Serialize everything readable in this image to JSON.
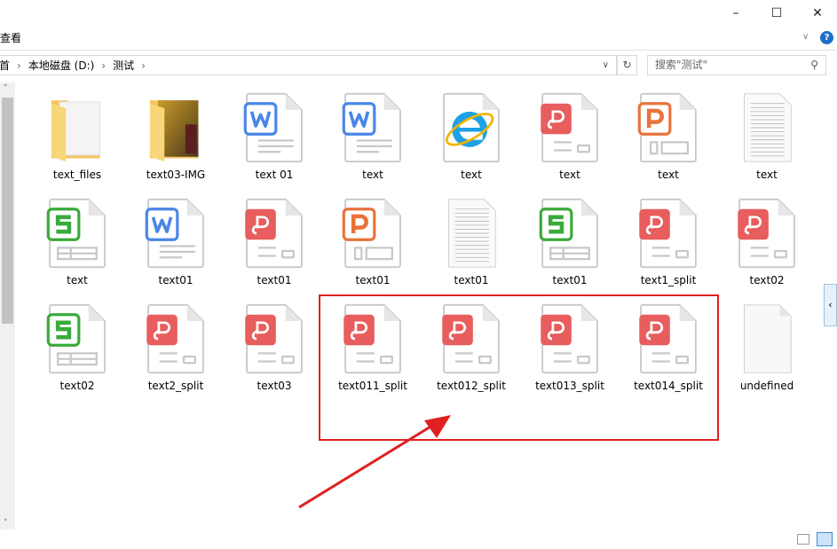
{
  "window": {
    "minimize": "–",
    "maximize": "☐",
    "close": "✕"
  },
  "ribbon": {
    "tab": "查看",
    "expand": "∨",
    "help": "?"
  },
  "address": {
    "crumbs": [
      "首",
      "本地磁盘 (D:)",
      "测试"
    ],
    "separator": "›",
    "dropdown": "∨",
    "refresh": "↻"
  },
  "search": {
    "placeholder": "搜索\"测试\"",
    "icon": "⚲"
  },
  "files": [
    {
      "name": "text_files",
      "type": "folder"
    },
    {
      "name": "text03-IMG",
      "type": "folder-image"
    },
    {
      "name": "text 01",
      "type": "word"
    },
    {
      "name": "text",
      "type": "word"
    },
    {
      "name": "text",
      "type": "html"
    },
    {
      "name": "text",
      "type": "pdf"
    },
    {
      "name": "text",
      "type": "ppt"
    },
    {
      "name": "text",
      "type": "txt"
    },
    {
      "name": "text",
      "type": "sheet"
    },
    {
      "name": "text01",
      "type": "word"
    },
    {
      "name": "text01",
      "type": "pdf"
    },
    {
      "name": "text01",
      "type": "ppt"
    },
    {
      "name": "text01",
      "type": "txt"
    },
    {
      "name": "text01",
      "type": "sheet"
    },
    {
      "name": "text1_split",
      "type": "pdf"
    },
    {
      "name": "text02",
      "type": "pdf"
    },
    {
      "name": "text02",
      "type": "sheet"
    },
    {
      "name": "text2_split",
      "type": "pdf"
    },
    {
      "name": "text03",
      "type": "pdf"
    },
    {
      "name": "text011_split",
      "type": "pdf"
    },
    {
      "name": "text012_split",
      "type": "pdf"
    },
    {
      "name": "text013_split",
      "type": "pdf"
    },
    {
      "name": "text014_split",
      "type": "pdf"
    },
    {
      "name": "undefined",
      "type": "blank"
    }
  ],
  "colors": {
    "word": "#4a86e8",
    "pdf": "#e85d5d",
    "ppt": "#e8733a",
    "sheet": "#3aaa3a",
    "highlight": "#e02020"
  },
  "sidebar_toggle": "‹",
  "scroll": {
    "up": "˄",
    "down": "˅"
  }
}
